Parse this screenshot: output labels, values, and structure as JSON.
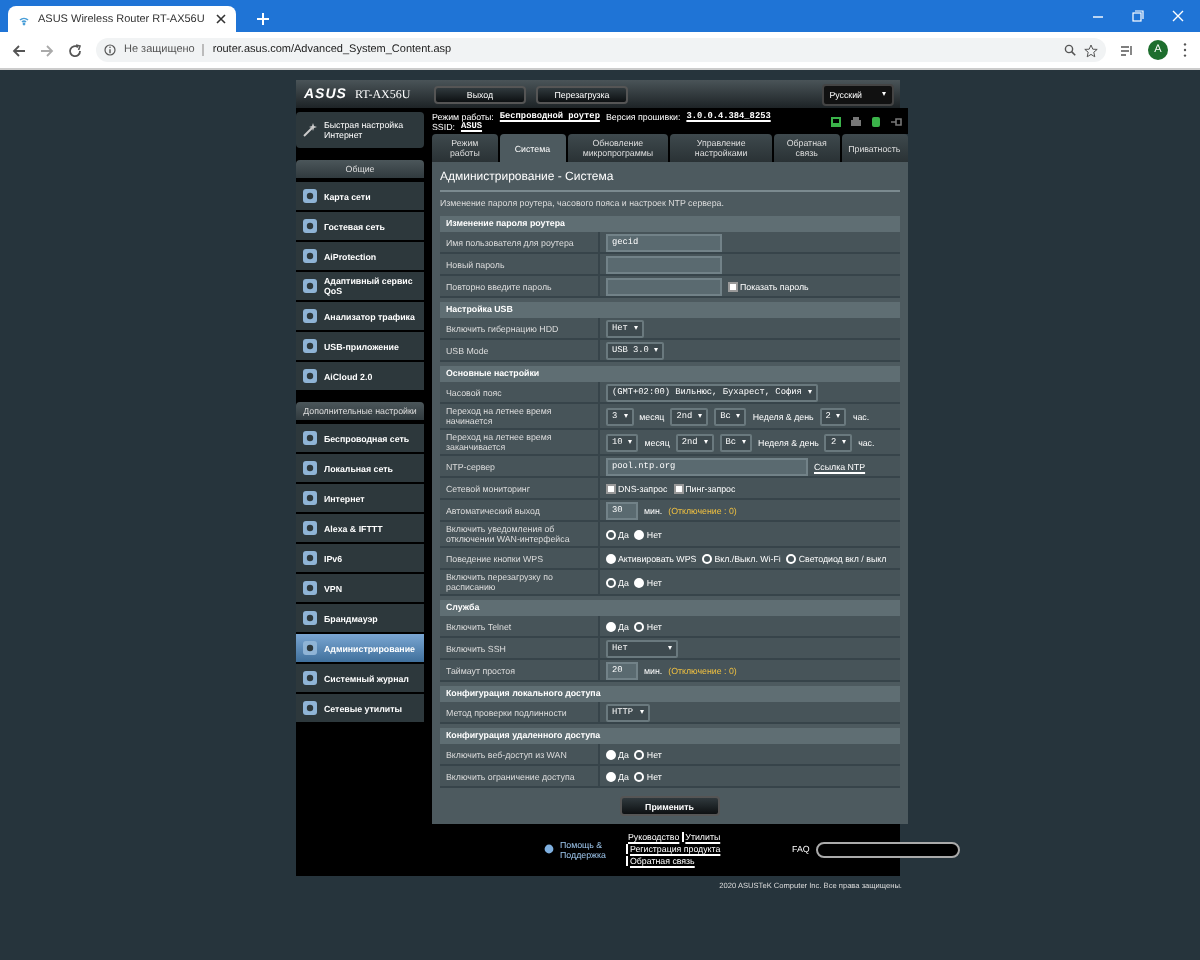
{
  "browser": {
    "tab": {
      "title": "ASUS Wireless Router RT-AX56U"
    },
    "security": "Не защищено",
    "url": "router.asus.com/Advanced_System_Content.asp",
    "avatar": "A"
  },
  "header": {
    "logo": "ASUS",
    "model": "RT-AX56U",
    "buttons": [
      "Выход",
      "Перезагрузка"
    ],
    "language": "Русский"
  },
  "info": {
    "lines": [
      [
        {
          "kind": "text",
          "text": "Режим работы:"
        },
        {
          "kind": "link",
          "text": "Беспроводной роутер"
        },
        {
          "kind": "text",
          "text": "Версия прошивки:"
        },
        {
          "kind": "link",
          "text": "3.0.0.4.384_8253"
        }
      ],
      [
        {
          "kind": "text",
          "text": "SSID:"
        },
        {
          "kind": "link",
          "text": "ASUS"
        }
      ]
    ]
  },
  "sidebar": {
    "quick_setup": "Быстрая настройка Интернет",
    "groups": [
      {
        "title": "Общие",
        "items": [
          {
            "label": "Карта сети",
            "selected": false
          },
          {
            "label": "Гостевая сеть",
            "selected": false
          },
          {
            "label": "AiProtection",
            "selected": false
          },
          {
            "label": "Адаптивный сервис QoS",
            "selected": false
          },
          {
            "label": "Анализатор трафика",
            "selected": false
          },
          {
            "label": "USB-приложение",
            "selected": false
          },
          {
            "label": "AiCloud 2.0",
            "selected": false
          }
        ]
      },
      {
        "title": "Дополнительные настройки",
        "items": [
          {
            "label": "Беспроводная сеть",
            "selected": false
          },
          {
            "label": "Локальная сеть",
            "selected": false
          },
          {
            "label": "Интернет",
            "selected": false
          },
          {
            "label": "Alexa & IFTTT",
            "selected": false
          },
          {
            "label": "IPv6",
            "selected": false
          },
          {
            "label": "VPN",
            "selected": false
          },
          {
            "label": "Брандмауэр",
            "selected": false
          },
          {
            "label": "Администрирование",
            "selected": true
          },
          {
            "label": "Системный журнал",
            "selected": false
          },
          {
            "label": "Сетевые утилиты",
            "selected": false
          }
        ]
      }
    ]
  },
  "tabs": [
    {
      "label": "Режим работы",
      "selected": false
    },
    {
      "label": "Система",
      "selected": true
    },
    {
      "label": "Обновление микропрограммы",
      "selected": false
    },
    {
      "label": "Управление настройками",
      "selected": false
    },
    {
      "label": "Обратная связь",
      "selected": false
    },
    {
      "label": "Приватность",
      "selected": false
    }
  ],
  "page": {
    "title": "Администрирование - Система",
    "description": "Изменение пароля роутера, часового пояса и настроек NTP сервера.",
    "sections": [
      {
        "title": "Изменение пароля роутера",
        "rows": [
          {
            "label": "Имя пользователя для роутера",
            "controls": [
              {
                "kind": "input",
                "value": "gecid"
              }
            ]
          },
          {
            "label": "Новый пароль",
            "controls": [
              {
                "kind": "input"
              }
            ]
          },
          {
            "label": "Повторно введите пароль",
            "controls": [
              {
                "kind": "input"
              },
              {
                "kind": "checkbox",
                "label": "Показать пароль",
                "checked": false
              }
            ]
          }
        ]
      },
      {
        "title": "Настройка USB",
        "rows": [
          {
            "label": "Включить гибернацию HDD",
            "controls": [
              {
                "kind": "select",
                "value": "Нет"
              }
            ]
          },
          {
            "label": "USB Mode",
            "controls": [
              {
                "kind": "select",
                "value": "USB 3.0"
              }
            ]
          }
        ]
      },
      {
        "title": "Основные настройки",
        "rows": [
          {
            "label": "Часовой пояс",
            "controls": [
              {
                "kind": "select",
                "value": "(GMT+02:00) Вильнюс, Бухарест, София"
              }
            ]
          },
          {
            "label": "Переход на летнее время начинается",
            "controls": [
              {
                "kind": "select",
                "value": "3"
              },
              {
                "kind": "text",
                "text": "месяц"
              },
              {
                "kind": "select",
                "value": "2nd"
              },
              {
                "kind": "select",
                "value": "Вс"
              },
              {
                "kind": "text",
                "text": "Неделя & день"
              },
              {
                "kind": "select",
                "value": "2"
              },
              {
                "kind": "text",
                "text": "час."
              }
            ]
          },
          {
            "label": "Переход на летнее время заканчивается",
            "controls": [
              {
                "kind": "select",
                "value": "10"
              },
              {
                "kind": "text",
                "text": "месяц"
              },
              {
                "kind": "select",
                "value": "2nd"
              },
              {
                "kind": "select",
                "value": "Вс"
              },
              {
                "kind": "text",
                "text": "Неделя & день"
              },
              {
                "kind": "select",
                "value": "2"
              },
              {
                "kind": "text",
                "text": "час."
              }
            ]
          },
          {
            "label": "NTP-сервер",
            "controls": [
              {
                "kind": "input",
                "value": "pool.ntp.org",
                "wide": true
              },
              {
                "kind": "link",
                "text": "Ссылка NTP"
              }
            ]
          },
          {
            "label": "Сетевой мониторинг",
            "controls": [
              {
                "kind": "checkbox",
                "label": "DNS-запрос",
                "checked": false
              },
              {
                "kind": "checkbox",
                "label": "Пинг-запрос",
                "checked": false
              }
            ]
          },
          {
            "label": "Автоматический выход",
            "controls": [
              {
                "kind": "input",
                "value": "30",
                "short": true
              },
              {
                "kind": "text",
                "text": "мин."
              },
              {
                "kind": "note",
                "text": "(Отключение : 0)"
              }
            ]
          },
          {
            "label": "Включить уведомления об отключении WAN-интерфейса",
            "controls": [
              {
                "kind": "radio",
                "label": "Да",
                "selected": false
              },
              {
                "kind": "radio",
                "label": "Нет",
                "selected": true
              }
            ]
          },
          {
            "label": "Поведение кнопки WPS",
            "controls": [
              {
                "kind": "radio",
                "label": "Активировать WPS",
                "selected": true
              },
              {
                "kind": "radio",
                "label": "Вкл./Выкл. Wi-Fi",
                "selected": false
              },
              {
                "kind": "radio",
                "label": "Светодиод вкл / выкл",
                "selected": false
              }
            ]
          },
          {
            "label": "Включить перезагрузку по расписанию",
            "controls": [
              {
                "kind": "radio",
                "label": "Да",
                "selected": false
              },
              {
                "kind": "radio",
                "label": "Нет",
                "selected": true
              }
            ]
          }
        ]
      },
      {
        "title": "Служба",
        "rows": [
          {
            "label": "Включить Telnet",
            "controls": [
              {
                "kind": "radio",
                "label": "Да",
                "selected": true
              },
              {
                "kind": "radio",
                "label": "Нет",
                "selected": false
              }
            ]
          },
          {
            "label": "Включить SSH",
            "controls": [
              {
                "kind": "select",
                "value": "Нет",
                "wide": true
              }
            ]
          },
          {
            "label": "Таймаут простоя",
            "controls": [
              {
                "kind": "input",
                "value": "20",
                "short": true
              },
              {
                "kind": "text",
                "text": "мин."
              },
              {
                "kind": "note",
                "text": "(Отключение : 0)"
              }
            ]
          }
        ]
      },
      {
        "title": "Конфигурация локального доступа",
        "rows": [
          {
            "label": "Метод проверки подлинности",
            "controls": [
              {
                "kind": "select",
                "value": "HTTP"
              }
            ]
          }
        ]
      },
      {
        "title": "Конфигурация удаленного доступа",
        "rows": [
          {
            "label": "Включить веб-доступ из WAN",
            "controls": [
              {
                "kind": "radio",
                "label": "Да",
                "selected": true
              },
              {
                "kind": "radio",
                "label": "Нет",
                "selected": false
              }
            ]
          },
          {
            "label": "Включить ограничение доступа",
            "controls": [
              {
                "kind": "radio",
                "label": "Да",
                "selected": true
              },
              {
                "kind": "radio",
                "label": "Нет",
                "selected": false
              }
            ]
          }
        ]
      }
    ],
    "apply": "Применить"
  },
  "footer": {
    "help": "Помощь & Поддержка",
    "links": [
      "Руководство",
      "Утилиты",
      "Регистрация продукта",
      "Обратная связь"
    ],
    "faq": "FAQ",
    "copyright": "2020 ASUSTeK Computer Inc. Все права защищены."
  }
}
